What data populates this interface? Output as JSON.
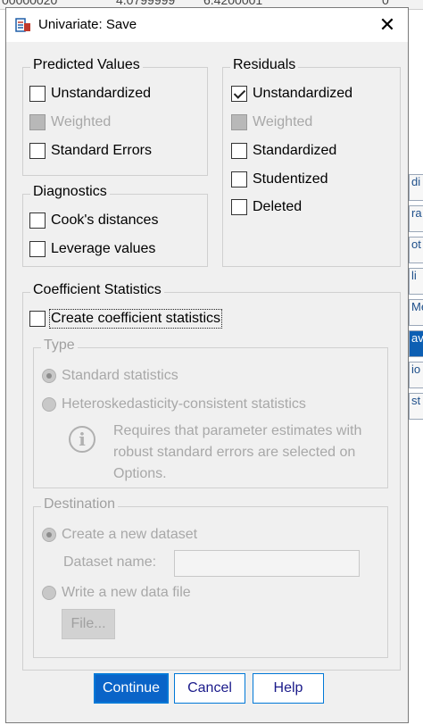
{
  "window": {
    "title": "Univariate: Save",
    "close_glyph": "✕"
  },
  "background": {
    "top_values": [
      "00000020",
      "4.0799999",
      "6.4200001",
      "0"
    ],
    "right_tabs": [
      "di",
      "ra",
      "ot",
      "li",
      "Me",
      "av",
      "io",
      "st"
    ]
  },
  "predicted": {
    "legend": "Predicted Values",
    "items": [
      {
        "label": "Unstandardized",
        "state": "unchecked"
      },
      {
        "label": "Weighted",
        "state": "disabled"
      },
      {
        "label": "Standard Errors",
        "state": "unchecked"
      }
    ]
  },
  "residuals": {
    "legend": "Residuals",
    "items": [
      {
        "label": "Unstandardized",
        "state": "checked"
      },
      {
        "label": "Weighted",
        "state": "disabled"
      },
      {
        "label": "Standardized",
        "state": "unchecked"
      },
      {
        "label": "Studentized",
        "state": "unchecked"
      },
      {
        "label": "Deleted",
        "state": "unchecked"
      }
    ]
  },
  "diagnostics": {
    "legend": "Diagnostics",
    "items": [
      {
        "label": "Cook's distances",
        "state": "unchecked"
      },
      {
        "label": "Leverage values",
        "state": "unchecked"
      }
    ]
  },
  "coefficient": {
    "legend": "Coefficient Statistics",
    "create_label": "Create coefficient statistics",
    "type": {
      "legend": "Type",
      "standard": "Standard statistics",
      "hetero": "Heteroskedasticity-consistent statistics",
      "note_line1": "Requires that parameter estimates with",
      "note_line2": "robust standard errors are selected on",
      "note_line3": "Options."
    },
    "destination": {
      "legend": "Destination",
      "new_dataset": "Create a new dataset",
      "dataset_name_label": "Dataset name:",
      "dataset_name_value": "",
      "write_file": "Write a new data file",
      "file_button": "File..."
    }
  },
  "buttons": {
    "continue": "Continue",
    "cancel": "Cancel",
    "help": "Help"
  }
}
